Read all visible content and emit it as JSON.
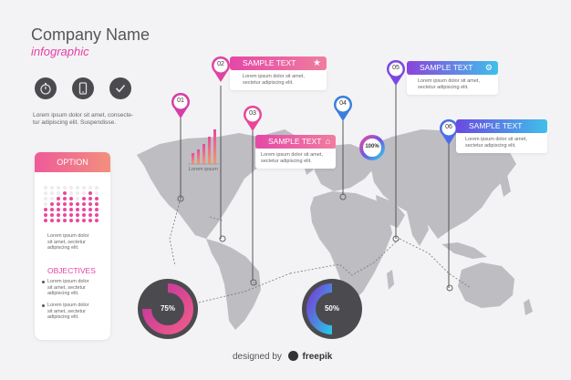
{
  "header": {
    "title": "Company Name",
    "subtitle": "infographic"
  },
  "icons": [
    "stopwatch-icon",
    "phone-icon",
    "check-icon"
  ],
  "intro_text": [
    "Lorem ipsum dolor sit amet, consecte-",
    "tur adipiscing elit. Suspendisse."
  ],
  "panel": {
    "title": "OPTION",
    "body_text": [
      "Lorem ipsum dolor",
      "sit amet, sectetur",
      "adipiscing elit."
    ],
    "objectives_title": "OBJECTIVES",
    "objectives": [
      [
        "Lorem ipsum dolor",
        "sit amet, sectetur",
        "adipiscing elit."
      ],
      [
        "Lorem ipsum dolor",
        "sit amet, sectetur",
        "adipiscing elit."
      ]
    ]
  },
  "pins": [
    {
      "number": "01",
      "color": "#d53ea8"
    },
    {
      "number": "02",
      "color": "#e0449e"
    },
    {
      "number": "03",
      "color": "#e9479a"
    },
    {
      "number": "04",
      "color": "#3b7fdc"
    },
    {
      "number": "05",
      "color": "#7a4ae0"
    },
    {
      "number": "06",
      "color": "#4a6ee5"
    }
  ],
  "cards": {
    "card2": {
      "title": "SAMPLE TEXT",
      "lines": [
        "Lorem ipsum dolor sit amet,",
        "sectetur adipiscing elit."
      ]
    },
    "card3": {
      "title": "SAMPLE TEXT",
      "lines": [
        "Lorem ipsum dolor sit amet,",
        "sectetur adipiscing elit."
      ]
    },
    "card5": {
      "title": "SAMPLE TEXT",
      "lines": [
        "Lorem ipsum dolor sit amet,",
        "sectetur adipiscing elit."
      ]
    },
    "card6": {
      "title": "SAMPLE TEXT",
      "lines": [
        "Lorem ipsum dolor sit amet,",
        "sectetur adipiscing elit."
      ]
    }
  },
  "mini_bar_label": "Lorem ipsum",
  "donuts": {
    "small": "100%",
    "left": "75%",
    "right": "50%"
  },
  "footer": {
    "prefix": "designed by",
    "brand": "freepik"
  }
}
